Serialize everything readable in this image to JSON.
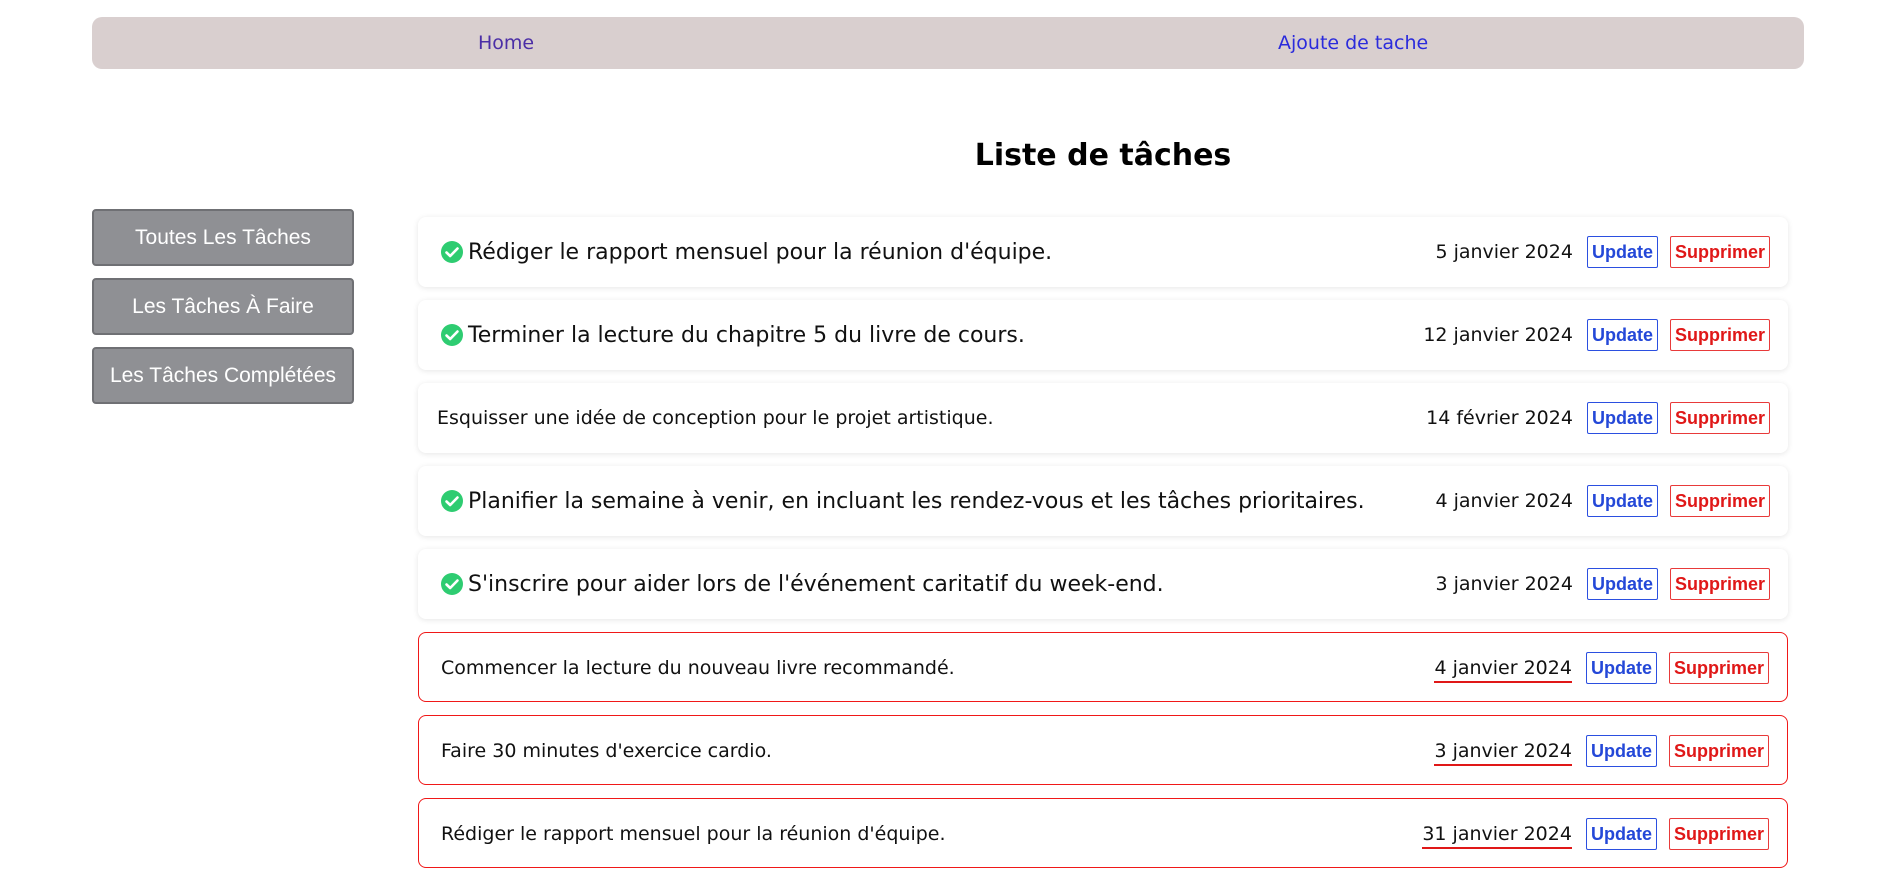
{
  "nav": {
    "home_label": "Home",
    "add_label": "Ajoute de tache"
  },
  "page": {
    "title": "Liste de tâches"
  },
  "sidebar": {
    "items": [
      {
        "label": "Toutes Les Tâches"
      },
      {
        "label": "Les Tâches À Faire"
      },
      {
        "label": "Les Tâches Complétées"
      }
    ]
  },
  "colors": {
    "navbar_bg": "#d9cfcf",
    "sidebar_button_bg": "#8f9094",
    "completed_check": "#2ecc71",
    "overdue_border": "#f01818",
    "update_blue": "#2448d8",
    "delete_red": "#e01818"
  },
  "tasks": [
    {
      "text": "Rédiger le rapport mensuel pour la réunion d'équipe.",
      "date": "5 janvier 2024",
      "status": "completed",
      "update_label": "Update",
      "delete_label": "Supprimer"
    },
    {
      "text": "Terminer la lecture du chapitre 5 du livre de cours.",
      "date": "12 janvier 2024",
      "status": "completed",
      "update_label": "Update",
      "delete_label": "Supprimer"
    },
    {
      "text": "Esquisser une idée de conception pour le projet artistique.",
      "date": "14 février 2024",
      "status": "pending",
      "update_label": "Update",
      "delete_label": "Supprimer"
    },
    {
      "text": "Planifier la semaine à venir, en incluant les rendez-vous et les tâches prioritaires.",
      "date": "4 janvier 2024",
      "status": "completed",
      "update_label": "Update",
      "delete_label": "Supprimer"
    },
    {
      "text": "S'inscrire pour aider lors de l'événement caritatif du week-end.",
      "date": "3 janvier 2024",
      "status": "completed",
      "update_label": "Update",
      "delete_label": "Supprimer"
    },
    {
      "text": "Commencer la lecture du nouveau livre recommandé.",
      "date": "4 janvier 2024",
      "status": "overdue",
      "update_label": "Update",
      "delete_label": "Supprimer"
    },
    {
      "text": "Faire 30 minutes d'exercice cardio.",
      "date": "3 janvier 2024",
      "status": "overdue",
      "update_label": "Update",
      "delete_label": "Supprimer"
    },
    {
      "text": "Rédiger le rapport mensuel pour la réunion d'équipe.",
      "date": "31 janvier 2024",
      "status": "overdue",
      "update_label": "Update",
      "delete_label": "Supprimer"
    }
  ]
}
